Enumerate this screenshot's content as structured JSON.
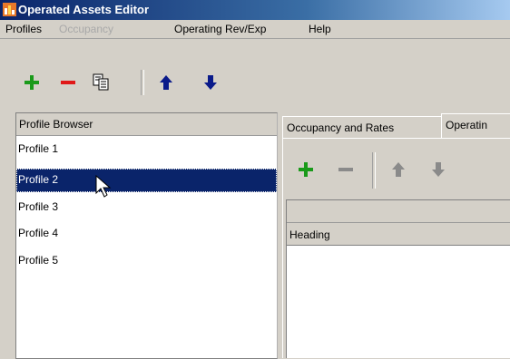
{
  "window": {
    "title": "Operated Assets Editor"
  },
  "menu": [
    {
      "label": "Profiles",
      "enabled": true
    },
    {
      "label": "Occupancy",
      "enabled": false
    },
    {
      "label": "Operating Rev/Exp",
      "enabled": true
    },
    {
      "label": "Help",
      "enabled": true
    }
  ],
  "toolbar": {
    "icons": [
      "add-icon",
      "remove-icon",
      "copy-icon",
      "move-up-icon",
      "move-down-icon"
    ]
  },
  "profile_browser": {
    "header": "Profile Browser",
    "items": [
      "Profile 1",
      "Profile 2",
      "Profile 3",
      "Profile 4",
      "Profile 5"
    ],
    "selected_index": 1
  },
  "tabs": [
    {
      "label": "Occupancy and Rates"
    },
    {
      "label": "Operatin"
    }
  ],
  "detail_table": {
    "column_header": "Heading"
  },
  "colors": {
    "selection": "#0a246a",
    "add": "#1a9a1a",
    "remove": "#e01818",
    "arrow": "#0a1a8a"
  }
}
